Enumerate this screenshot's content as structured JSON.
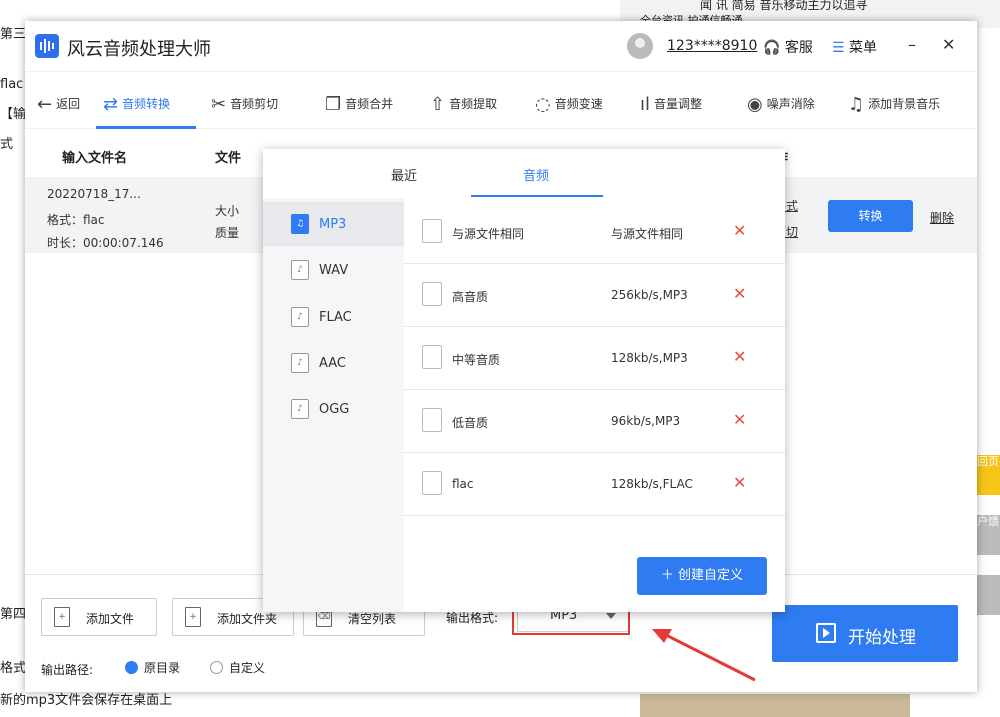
{
  "background": {
    "left_snippets": [
      "第三",
      "flac",
      "【输",
      "式",
      "第四",
      "格式：",
      "新的mp3文件会保存在桌面上"
    ],
    "top_right": {
      "line1": "闻 讯  简易 音乐移动主力以追寻",
      "line2": "全台资讯  护通信畅通"
    },
    "right_tabs": [
      "回页",
      "户馈"
    ]
  },
  "app": {
    "title": "风云音频处理大师",
    "account": "123****8910",
    "service": "客服",
    "menu": "菜单",
    "minimize": "–",
    "close": "✕"
  },
  "toolbar": {
    "back": "返回",
    "items": [
      {
        "label": "音频转换",
        "icon": "convert-icon"
      },
      {
        "label": "音频剪切",
        "icon": "scissors-icon"
      },
      {
        "label": "音频合并",
        "icon": "merge-icon"
      },
      {
        "label": "音频提取",
        "icon": "extract-icon"
      },
      {
        "label": "音频变速",
        "icon": "speed-icon"
      },
      {
        "label": "音量调整",
        "icon": "volume-icon"
      },
      {
        "label": "噪声消除",
        "icon": "noise-icon"
      },
      {
        "label": "添加背景音乐",
        "icon": "music-icon"
      }
    ]
  },
  "table": {
    "headers": {
      "filename": "输入文件名",
      "info": "文件",
      "ops": "操作"
    },
    "row": {
      "name": "20220718_17...",
      "format": "格式：flac",
      "duration": "时长：00:00:07.146",
      "size": "大小",
      "quality": "质量",
      "out_format_link": "出格式",
      "clip_link": "频剪切",
      "convert": "转换",
      "delete": "删除"
    }
  },
  "popup": {
    "tabs": [
      "最近",
      "音频"
    ],
    "formats": [
      "MP3",
      "WAV",
      "FLAC",
      "AAC",
      "OGG"
    ],
    "selected_format": "MP3",
    "options": [
      {
        "name": "与源文件相同",
        "value": "与源文件相同"
      },
      {
        "name": "高音质",
        "value": "256kb/s,MP3"
      },
      {
        "name": "中等音质",
        "value": "128kb/s,MP3"
      },
      {
        "name": "低音质",
        "value": "96kb/s,MP3"
      },
      {
        "name": "flac",
        "value": "128kb/s,FLAC"
      }
    ],
    "create_custom": "＋ 创建自定义"
  },
  "bottom": {
    "add_file": "添加文件",
    "add_folder": "添加文件夹",
    "clear_list": "清空列表",
    "output_format_label": "输出格式:",
    "output_format_value": "MP3",
    "output_path_label": "输出路径:",
    "path_original": "原目录",
    "path_custom": "自定义",
    "start": "开始处理"
  },
  "colors": {
    "accent": "#2f7bf2",
    "highlight": "#e53935"
  }
}
